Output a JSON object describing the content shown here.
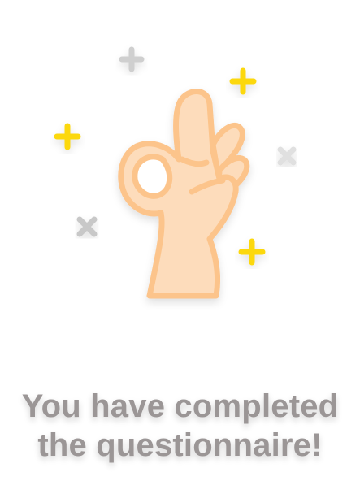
{
  "message": {
    "line1": "You have completed",
    "line2": "the questionnaire!"
  },
  "illustration": {
    "main_icon": "ok-hand-icon",
    "decorations": [
      "plus-icon",
      "plus-icon",
      "plus-icon",
      "plus-icon",
      "close-icon",
      "close-icon"
    ]
  },
  "colors": {
    "hand_fill": "#fddcbb",
    "hand_outline": "#fcc48b",
    "accent_yellow": "#fcd80a",
    "decoration_gray": "#cfcfcf",
    "text": "#9b9696",
    "background": "#ffffff"
  }
}
